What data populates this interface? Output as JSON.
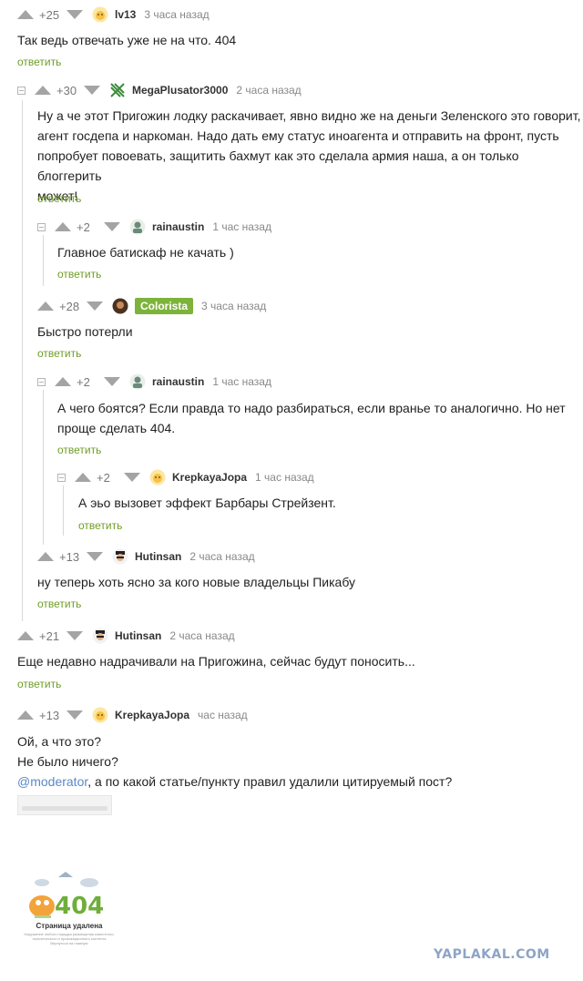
{
  "reply_label": "ответить",
  "comments": [
    {
      "rating": "+25",
      "nick": "lv13",
      "time": "3 часа назад",
      "lines": [
        "Так ведь отвечать уже не на что. 404"
      ]
    },
    {
      "rating": "+30",
      "nick": "MegaPlusator3000",
      "time": "2 часа назад",
      "lines": [
        "Ну а че этот Пригожин лодку раскачивает,  явно видно же на деньги Зеленского это говорит,",
        "агент госдепа и наркоман. Надо дать ему статус иноагента и отправить на фронт, пусть",
        "попробует повоевать, защитить бахмут как это сделала армия наша, а он только блоггерить",
        "может!"
      ]
    },
    {
      "rating": "+2",
      "nick": "rainaustin",
      "time": "1 час назад",
      "lines": [
        "Главное батискаф не качать )"
      ]
    },
    {
      "rating": "+28",
      "nick": "Colorista",
      "time": "3 часа назад",
      "lines": [
        "Быстро потерли"
      ]
    },
    {
      "rating": "+2",
      "nick": "rainaustin",
      "time": "1 час назад",
      "lines": [
        "А чего боятся? Если правда то надо разбираться, если вранье то аналогично. Но нет",
        "проще сделать 404."
      ]
    },
    {
      "rating": "+2",
      "nick": "KrepkayaJopa",
      "time": "1 час назад",
      "lines": [
        "А эьо вызовет эффект Барбары Стрейзент."
      ]
    },
    {
      "rating": "+13",
      "nick": "Hutinsan",
      "time": "2 часа назад",
      "lines": [
        "ну теперь хоть ясно за кого новые владельцы  Пикабу"
      ]
    },
    {
      "rating": "+21",
      "nick": "Hutinsan",
      "time": "2 часа назад",
      "lines": [
        "Еще недавно надрачивали на Пригожина, сейчас будут поносить..."
      ]
    },
    {
      "rating": "+13",
      "nick": "KrepkayaJopa",
      "time": "час назад",
      "lines": [
        "Ой, а что это?",
        "Не было ничего?"
      ],
      "mention": "@moderator",
      "mention_rest": ", а по какой статье/пункту правил удалили цитируемый пост?"
    }
  ],
  "error_image": {
    "code": "404",
    "title": "Страница удалена",
    "text": [
      "Нарушение любого порядка размещения известного,",
      "политического и провокационного контента",
      "Вернуться на главную"
    ]
  },
  "watermark": "YAPLAKAL.COM",
  "colors": {
    "reply": "#6f9e27",
    "badge": "#7db33b",
    "mention": "#5a89c9",
    "watermark": "#8ea4c4"
  }
}
